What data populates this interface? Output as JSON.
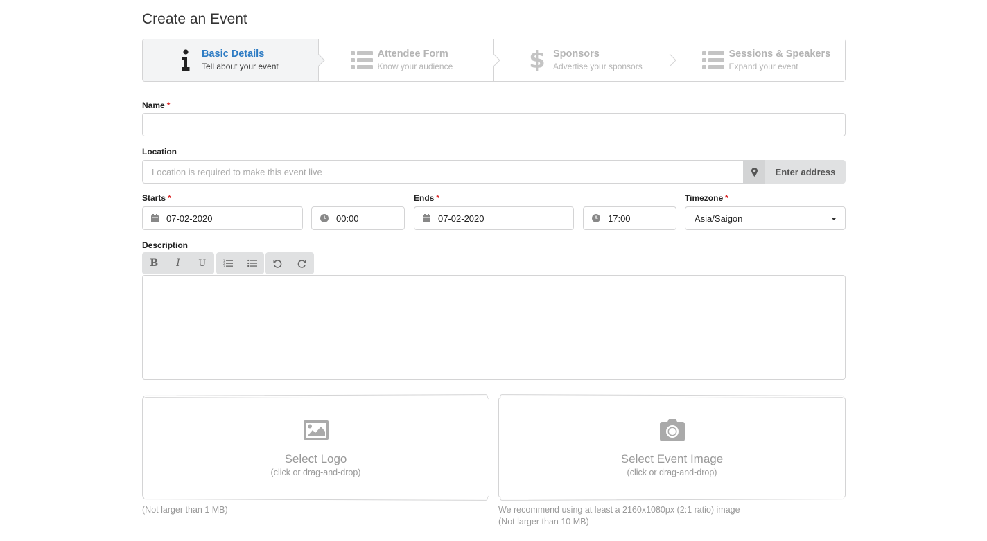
{
  "page": {
    "title": "Create an Event"
  },
  "steps": [
    {
      "title": "Basic Details",
      "description": "Tell about your event",
      "icon": "info-icon",
      "active": true
    },
    {
      "title": "Attendee Form",
      "description": "Know your audience",
      "icon": "list-icon",
      "active": false
    },
    {
      "title": "Sponsors",
      "description": "Advertise your sponsors",
      "icon": "dollar-icon",
      "active": false
    },
    {
      "title": "Sessions & Speakers",
      "description": "Expand your event",
      "icon": "list-icon",
      "active": false
    }
  ],
  "form": {
    "name": {
      "label": "Name",
      "required_mark": "*",
      "value": ""
    },
    "location": {
      "label": "Location",
      "placeholder": "Location is required to make this event live",
      "button_label": "Enter address",
      "button_icon": "map-pin-icon"
    },
    "starts": {
      "label": "Starts",
      "required_mark": "*",
      "date": "07-02-2020",
      "time": "00:00"
    },
    "ends": {
      "label": "Ends",
      "required_mark": "*",
      "date": "07-02-2020",
      "time": "17:00"
    },
    "timezone": {
      "label": "Timezone",
      "required_mark": "*",
      "value": "Asia/Saigon"
    },
    "description": {
      "label": "Description",
      "toolbar": {
        "bold": "B",
        "italic": "I",
        "underline": "U"
      },
      "value": ""
    }
  },
  "uploads": {
    "logo": {
      "title": "Select Logo",
      "subtitle": "(click or drag-and-drop)",
      "hint": "(Not larger than 1 MB)",
      "icon": "image-icon"
    },
    "event_image": {
      "title": "Select Event Image",
      "subtitle": "(click or drag-and-drop)",
      "hint_line1": "We recommend using at least a 2160x1080px (2:1 ratio) image",
      "hint_line2": "(Not larger than 10 MB)",
      "icon": "camera-icon"
    }
  },
  "colors": {
    "accent": "#2e7cc4",
    "required": "#db2828",
    "muted": "#b5b5b5"
  }
}
